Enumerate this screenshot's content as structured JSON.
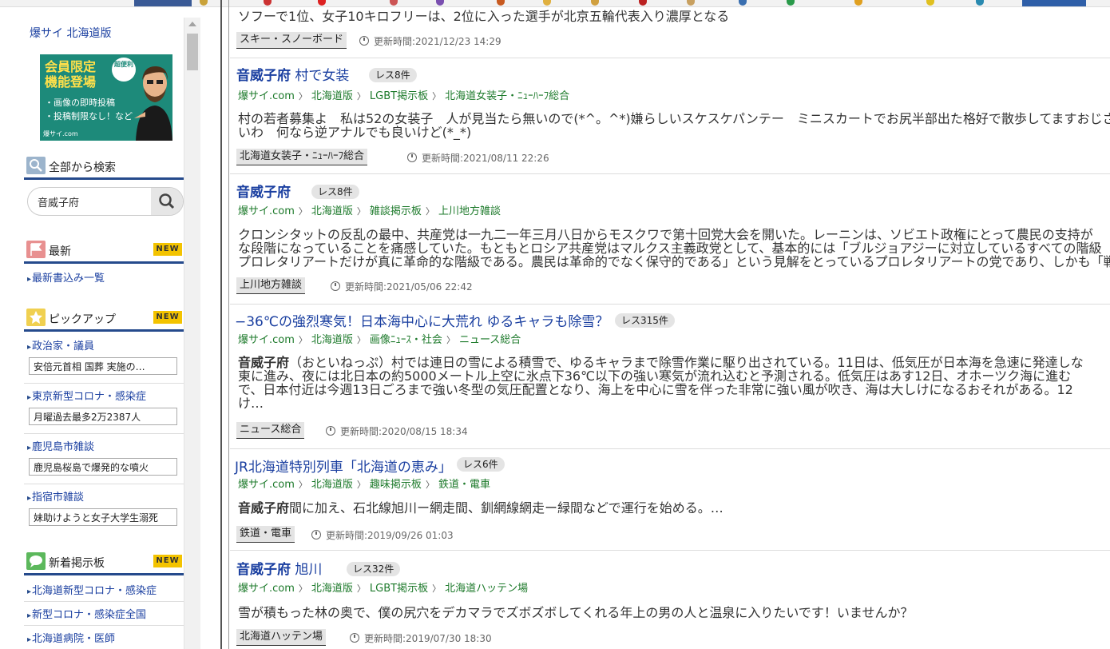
{
  "site": {
    "title": "爆サイ 北海道版"
  },
  "banner": {
    "line1": "会員限定",
    "line2": "機能登場",
    "badge": "超便利",
    "bullet1": "・画像の即時投稿",
    "bullet2": "・投稿制限なし！など",
    "brand": "爆サイ.com"
  },
  "search": {
    "heading": "全部から検索",
    "value": "音威子府"
  },
  "latest": {
    "heading": "最新",
    "badge": "NEW",
    "link": "最新書込み一覧"
  },
  "pickup": {
    "heading": "ピックアップ",
    "badge": "NEW",
    "items": [
      {
        "label": "政治家・議員",
        "desc": "安倍元首相 国葬 実施の…"
      },
      {
        "label": "東京新型コロナ・感染症",
        "desc": "月曜過去最多2万2387人"
      },
      {
        "label": "鹿児島市雑談",
        "desc": "鹿児島桜島で爆発的な噴火"
      },
      {
        "label": "指宿市雑談",
        "desc": "妹助けようと女子大学生溺死"
      }
    ]
  },
  "newboards": {
    "heading": "新着掲示板",
    "badge": "NEW",
    "items": [
      "北海道新型コロナ・感染症",
      "新型コロナ・感染症全国",
      "北海道病院・医師"
    ]
  },
  "results": [
    {
      "body": "ソフーで1位、女子10キロフリーは、2位に入った選手が北京五輪代表入り濃厚となる",
      "category": "スキー・スノーボード",
      "updated": "更新時間:2021/12/23 14:29"
    },
    {
      "title_bold": "音威子府",
      "title_rest": " 村で女装",
      "res": "レス8件",
      "crumbs": [
        "爆サイ.com",
        "北海道版",
        "LGBT掲示板",
        "北海道女装子・ﾆｭｰﾊｰﾌ総合"
      ],
      "body_lines": [
        "村の若者募集よ　私は52の女装子　人が見当たら無いので(*^。^*)嫌らしいスケスケパンテー　ミニスカートでお尻半部出た格好で散歩してますおじさん出て来ないかしら",
        "いわ　何なら逆アナルでも良いけど(*_*)"
      ],
      "category": "北海道女装子・ﾆｭｰﾊｰﾌ総合",
      "updated": "更新時間:2021/08/11 22:26"
    },
    {
      "title_bold": "音威子府",
      "title_rest": "",
      "res": "レス8件",
      "crumbs": [
        "爆サイ.com",
        "北海道版",
        "雑談掲示板",
        "上川地方雑談"
      ],
      "body_lines": [
        "クロンシタットの反乱の最中、共産党は一九二一年三月八日からモスクワで第十回党大会を開いた。レーニンは、ソビエト政権にとって農民の支持が",
        "な段階になっていることを痛感していた。もともとロシア共産党はマルクス主義政党として、基本的には「ブルジョアジーに対立しているすべての階級",
        "プロレタリアートだけが真に革命的な階級である。農民は革命的でなく保守的である」という見解をとっているプロレタリアートの党であり、しかも「戦"
      ],
      "category": "上川地方雑談",
      "updated": "更新時間:2021/05/06 22:42"
    },
    {
      "title_plain": "−36℃の強烈寒気！日本海中心に大荒れ ゆるキャラも除雪？",
      "res": "レス315件",
      "crumbs": [
        "爆サイ.com",
        "北海道版",
        "画像ﾆｭｰｽ・社会",
        "ニュース総合"
      ],
      "body_bold": "音威子府",
      "body_lines": [
        "（おといねっぷ）村では連日の雪による積雪で、ゆるキャラまで除雪作業に駆り出されている。11日は、低気圧が日本海を急速に発達しな",
        "東に進み、夜には北日本の約5000メートル上空に氷点下36℃以下の強い寒気が流れ込むと予測される。低気圧はあす12日、オホーツク海に進む",
        "で、日本付近は今週13日ごろまで強い冬型の気圧配置となり、海上を中心に雪を伴った非常に強い風が吹き、海は大しけになるおそれがある。12",
        "け…"
      ],
      "category": "ニュース総合",
      "updated": "更新時間:2020/08/15 18:34"
    },
    {
      "title_plain": "JR北海道特別列車「北海道の恵み」",
      "res": "レス6件",
      "crumbs": [
        "爆サイ.com",
        "北海道版",
        "趣味掲示板",
        "鉄道・電車"
      ],
      "body_bold": "音威子府",
      "body_lines": [
        "間に加え、石北線旭川ー網走間、釧網線網走ー緑間などで運行を始める。…"
      ],
      "category": "鉄道・電車",
      "updated": "更新時間:2019/09/26 01:03"
    },
    {
      "title_bold": "音威子府",
      "title_rest": " 旭川",
      "res": "レス32件",
      "crumbs": [
        "爆サイ.com",
        "北海道版",
        "LGBT掲示板",
        "北海道ハッテン場"
      ],
      "body_lines": [
        "雪が積もった林の奥で、僕の尻穴をデカマラでズボズボしてくれる年上の男の人と温泉に入りたいです！いませんか？"
      ],
      "category": "北海道ハッテン場",
      "updated": "更新時間:2019/07/30 18:30"
    }
  ],
  "colors": {
    "link": "#1a3fa0",
    "crumb": "#1d7a2b",
    "accent": "#254a8c",
    "new_badge": "#f3c300"
  },
  "icons": {
    "search": "search-icon",
    "latest": "flag-icon",
    "pickup": "star-icon",
    "newboards": "chat-icon",
    "updated": "clock-icon"
  }
}
